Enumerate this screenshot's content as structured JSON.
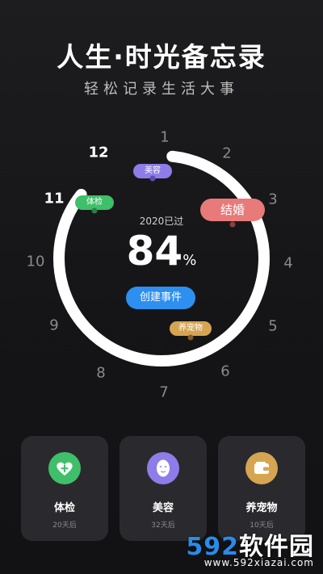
{
  "header": {
    "title": "人生·时光备忘录",
    "subtitle": "轻松记录生活大事"
  },
  "clock": {
    "hours": [
      "1",
      "2",
      "3",
      "4",
      "5",
      "6",
      "7",
      "8",
      "9",
      "10",
      "11",
      "12"
    ],
    "year_label": "2020已过",
    "percent_value": "84",
    "percent_unit": "%",
    "progress": 0.84,
    "create_button": "创建事件"
  },
  "tags": {
    "beauty": "美容",
    "checkup": "体检",
    "marriage": "结婚",
    "pet": "养宠物"
  },
  "colors": {
    "beauty": "#8e7ce8",
    "checkup": "#3fbf6a",
    "marriage": "#e87a7a",
    "pet": "#d6a552",
    "accent": "#2d8ff0",
    "card_bg": "#2a2a2e"
  },
  "cards": [
    {
      "title": "体检",
      "subtitle": "20天后",
      "icon": "heart-plus-icon"
    },
    {
      "title": "美容",
      "subtitle": "32天后",
      "icon": "face-mask-icon"
    },
    {
      "title": "养宠物",
      "subtitle": "10天后",
      "icon": "wallet-icon"
    }
  ],
  "watermark": {
    "brand_num": "592",
    "brand_text": "软件园",
    "url": "www.592xiazai.com"
  }
}
